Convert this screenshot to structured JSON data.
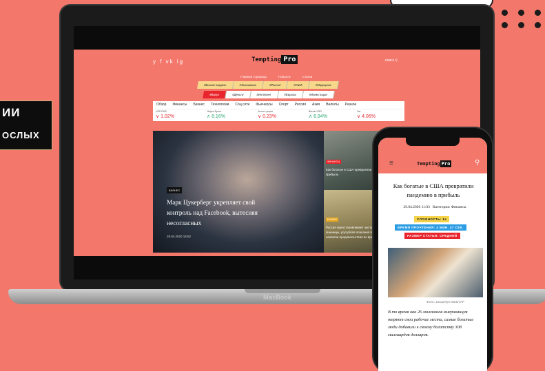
{
  "promo": {
    "line1": "ИИ",
    "line2": "ОСЛЫХ"
  },
  "laptop": {
    "brand": "MacBook",
    "site": {
      "social_icons": "y f vk ig",
      "logo_main": "Tempting",
      "logo_pro": "Pro",
      "search_label": "поиск",
      "top_nav": [
        "Главная страница",
        "Новости",
        "Статьи"
      ],
      "tags_row1": [
        "#Бизнес-модель",
        "#Экономика",
        "#Россия",
        "#США",
        "#Медицина"
      ],
      "tags_row2": [
        "#Вирус",
        "#Деньги",
        "#Интернет",
        "#Европа",
        "#Инвестиции"
      ],
      "categories": [
        "Обзор",
        "Финансы",
        "Бизнес",
        "Технологии",
        "Соц.сети",
        "Фьючерсы",
        "Спорт",
        "Россия",
        "Азия",
        "Валюты",
        "Разное"
      ],
      "ticker": [
        {
          "name": "USD RUB",
          "value": "1.02%",
          "dir": "down"
        },
        {
          "name": "Нефть Брент",
          "value": "8.16%",
          "dir": "up"
        },
        {
          "name": "Золото унция",
          "value": "0.23%",
          "dir": "down"
        },
        {
          "name": "Bitcoin USD",
          "value": "6.94%",
          "dir": "up"
        },
        {
          "name": "Газ",
          "value": "4.06%",
          "dir": "down"
        }
      ],
      "hero": {
        "tag": "БИЗНЕС",
        "title": "Марк Цукерберг укрепляет свой контроль над Facebook, вытесняя несогласных",
        "date": "29.04.2020 16:52"
      },
      "side_articles": [
        {
          "tag": "ФИНАНСЫ",
          "title": "Как богатые в США превратили пандемию в прибыль"
        },
        {
          "tag": "БИЗНЕС",
          "title": "Россия приостанавливает экспорт зерна, пшеницы, усугубляя опасения по поводу нехватки продовольствия во время кризиса"
        }
      ]
    }
  },
  "phone": {
    "logo_main": "Tempting",
    "logo_pro": "Pro",
    "article_title": "Как богатые в США превратили пандемию в прибыль",
    "date": "29.04.2020 11:03",
    "category": "Категория: Финансы",
    "badges": {
      "difficulty": "СЛОЖНОСТЬ: 8s",
      "reading_time": "ВРЕМЯ ПРОЧТЕНИЯ: 4 МИН. 47 СЕК.",
      "article_size": "РАЗМЕР СТАТЬИ: СРЕДНИЙ"
    },
    "photo_credit": "Фото: Jacquelyn Martin/AP",
    "lead_text": "В то время как 26 миллионов американцев теряют свои рабочие места, самые богатые люди добавили к своему богатству 308 миллиардов долларов."
  },
  "colors": {
    "background": "#f4776b",
    "accent_red": "#e8242c",
    "badge_yellow": "#f5d44a",
    "badge_blue": "#2c9de3"
  }
}
